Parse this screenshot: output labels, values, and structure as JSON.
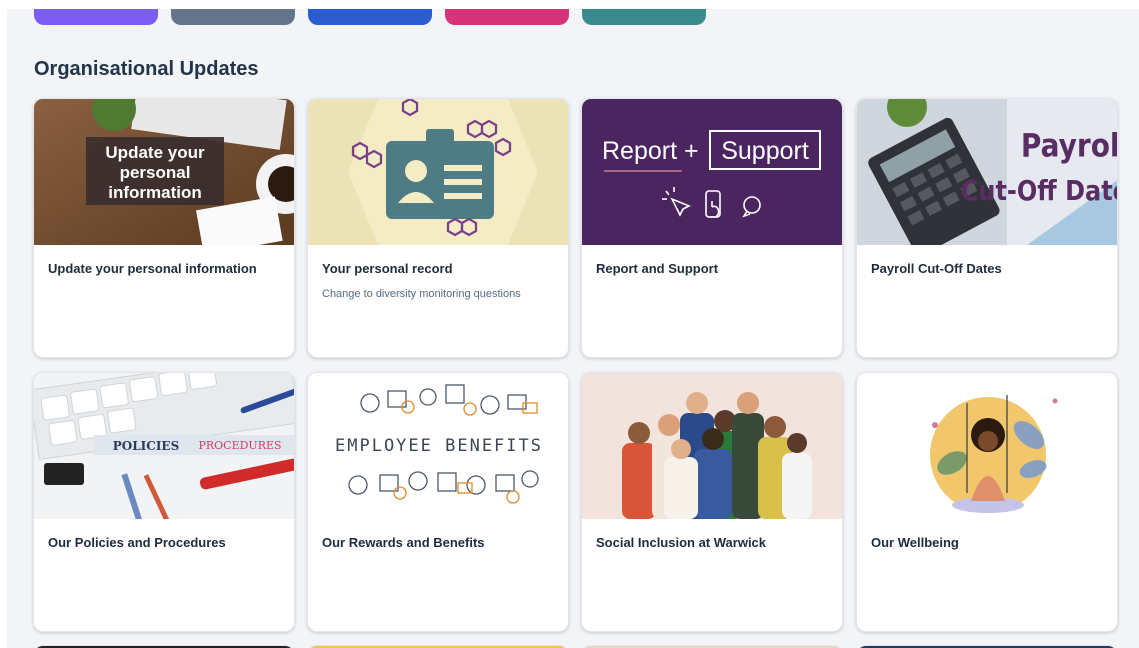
{
  "colors": {
    "pill_1": "#7b5cf0",
    "pill_2": "#64748b",
    "pill_3": "#2b5cd0",
    "pill_4": "#d6337a",
    "pill_5": "#3a8a8e"
  },
  "section": {
    "title": "Organisational Updates"
  },
  "cards": [
    {
      "title": "Update your personal information",
      "subtitle": "",
      "image_text": [
        "Update your",
        "personal",
        "information"
      ]
    },
    {
      "title": "Your personal record",
      "subtitle": "Change to diversity monitoring questions"
    },
    {
      "title": "Report and Support",
      "subtitle": "",
      "image_text_left": "Report +",
      "image_text_right": "Support"
    },
    {
      "title": "Payroll Cut-Off Dates",
      "subtitle": "",
      "image_text": [
        "Payroll",
        "Cut-Off Dates"
      ]
    },
    {
      "title": "Our Policies and Procedures",
      "subtitle": "",
      "image_text": [
        "POLICIES",
        "PROCEDURES"
      ]
    },
    {
      "title": "Our Rewards and Benefits",
      "subtitle": "",
      "image_text": "EMPLOYEE BENEFITS"
    },
    {
      "title": "Social Inclusion at Warwick",
      "subtitle": ""
    },
    {
      "title": "Our Wellbeing",
      "subtitle": ""
    }
  ]
}
